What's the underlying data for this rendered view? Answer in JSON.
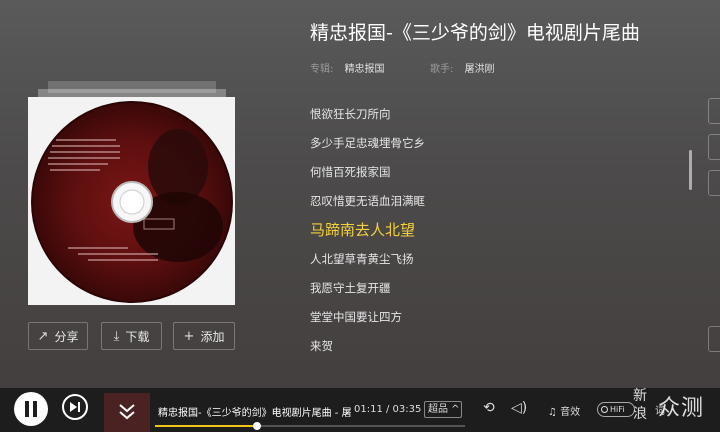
{
  "song": {
    "title": "精忠报国-《三少爷的剑》电视剧片尾曲",
    "album_key": "专辑:",
    "album": "精忠报国",
    "singer_key": "歌手:",
    "singer": "屠洪刚"
  },
  "actions": {
    "share": "分享",
    "download": "下载",
    "add": "添加"
  },
  "lyrics": [
    {
      "text": "恨欲狂长刀所向",
      "active": false
    },
    {
      "text": "多少手足忠魂埋骨它乡",
      "active": false
    },
    {
      "text": "何惜百死报家国",
      "active": false
    },
    {
      "text": "忍叹惜更无语血泪满眶",
      "active": false
    },
    {
      "text": "马蹄南去人北望",
      "active": true
    },
    {
      "text": "人北望草青黄尘飞扬",
      "active": false
    },
    {
      "text": "我愿守土复开疆",
      "active": false
    },
    {
      "text": "堂堂中国要让四方",
      "active": false
    },
    {
      "text": "来贺",
      "active": false
    }
  ],
  "player": {
    "title": "精忠报国-《三少爷的剑》电视剧片尾曲 - 屠",
    "time": "01:11 / 03:35",
    "progress": 0.33,
    "quality": "超品 ^",
    "effect_label": "音效",
    "hifi_label": "HiFi",
    "lyric_label": "词"
  },
  "colors": {
    "active_lyric": "#f4d13a",
    "progress": "#f0c419"
  },
  "watermark": {
    "logo": "新浪",
    "text": "众测"
  }
}
